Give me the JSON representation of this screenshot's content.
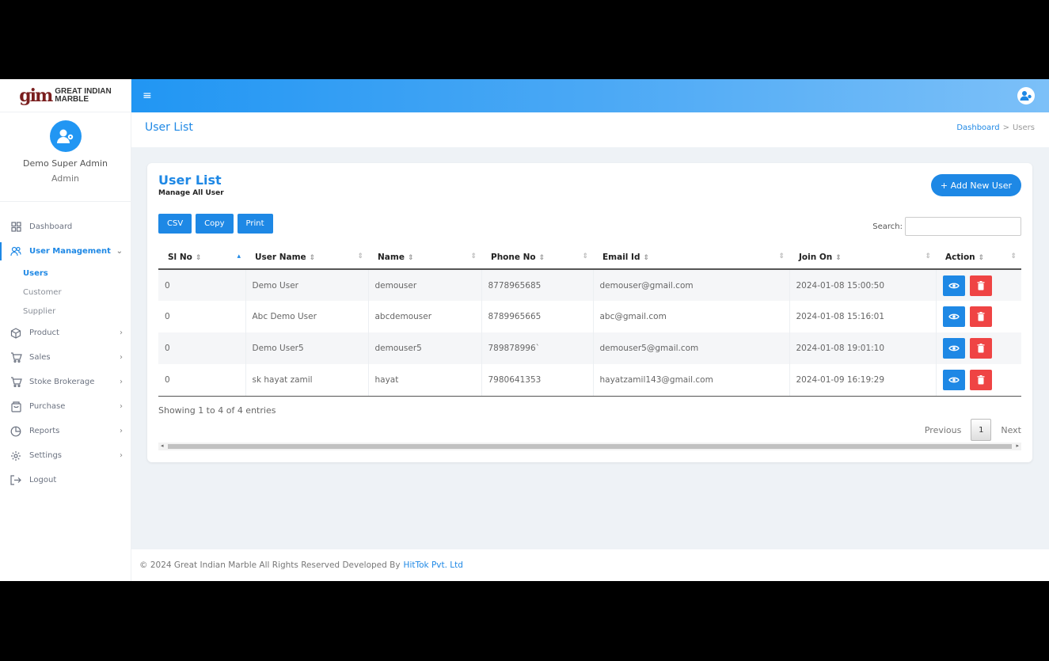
{
  "brand": {
    "logo_mark": "gim",
    "line1": "GREAT INDIAN",
    "line2": "MARBLE"
  },
  "profile": {
    "name": "Demo Super Admin",
    "role": "Admin"
  },
  "nav": {
    "dashboard": "Dashboard",
    "user_management": "User Management",
    "sub": {
      "users": "Users",
      "customer": "Customer",
      "supplier": "Supplier"
    },
    "product": "Product",
    "sales": "Sales",
    "stoke_brokerage": "Stoke Brokerage",
    "purchase": "Purchase",
    "reports": "Reports",
    "settings": "Settings",
    "logout": "Logout"
  },
  "header": {
    "title": "User List",
    "breadcrumb_home": "Dashboard",
    "breadcrumb_sep": ">",
    "breadcrumb_current": "Users"
  },
  "card": {
    "title": "User List",
    "subtitle": "Manage All User",
    "add_button": "+ Add New User",
    "tools": {
      "csv": "CSV",
      "copy": "Copy",
      "print": "Print"
    },
    "search_label": "Search:",
    "search_value": ""
  },
  "table": {
    "columns": {
      "sl": "Sl No",
      "username": "User Name",
      "name": "Name",
      "phone": "Phone No",
      "email": "Email Id",
      "join": "Join On",
      "action": "Action"
    },
    "rows": [
      {
        "sl": "0",
        "username": "Demo User",
        "name": "demouser",
        "phone": "8778965685",
        "email": "demouser@gmail.com",
        "join": "2024-01-08 15:00:50"
      },
      {
        "sl": "0",
        "username": "Abc Demo User",
        "name": "abcdemouser",
        "phone": "8789965665",
        "email": "abc@gmail.com",
        "join": "2024-01-08 15:16:01"
      },
      {
        "sl": "0",
        "username": "Demo User5",
        "name": "demouser5",
        "phone": "789878996`",
        "email": "demouser5@gmail.com",
        "join": "2024-01-08 19:01:10"
      },
      {
        "sl": "0",
        "username": "sk hayat zamil",
        "name": "hayat",
        "phone": "7980641353",
        "email": "hayatzamil143@gmail.com",
        "join": "2024-01-09 16:19:29"
      }
    ]
  },
  "entries_text": "Showing 1 to 4 of 4 entries",
  "pagination": {
    "previous": "Previous",
    "current": "1",
    "next": "Next"
  },
  "footer": {
    "text": "© 2024 Great Indian Marble All Rights Reserved Developed By",
    "link": "HitTok Pvt. Ltd"
  },
  "colors": {
    "accent": "#1e88e5",
    "danger": "#ef4444",
    "background": "#eef2f6"
  }
}
